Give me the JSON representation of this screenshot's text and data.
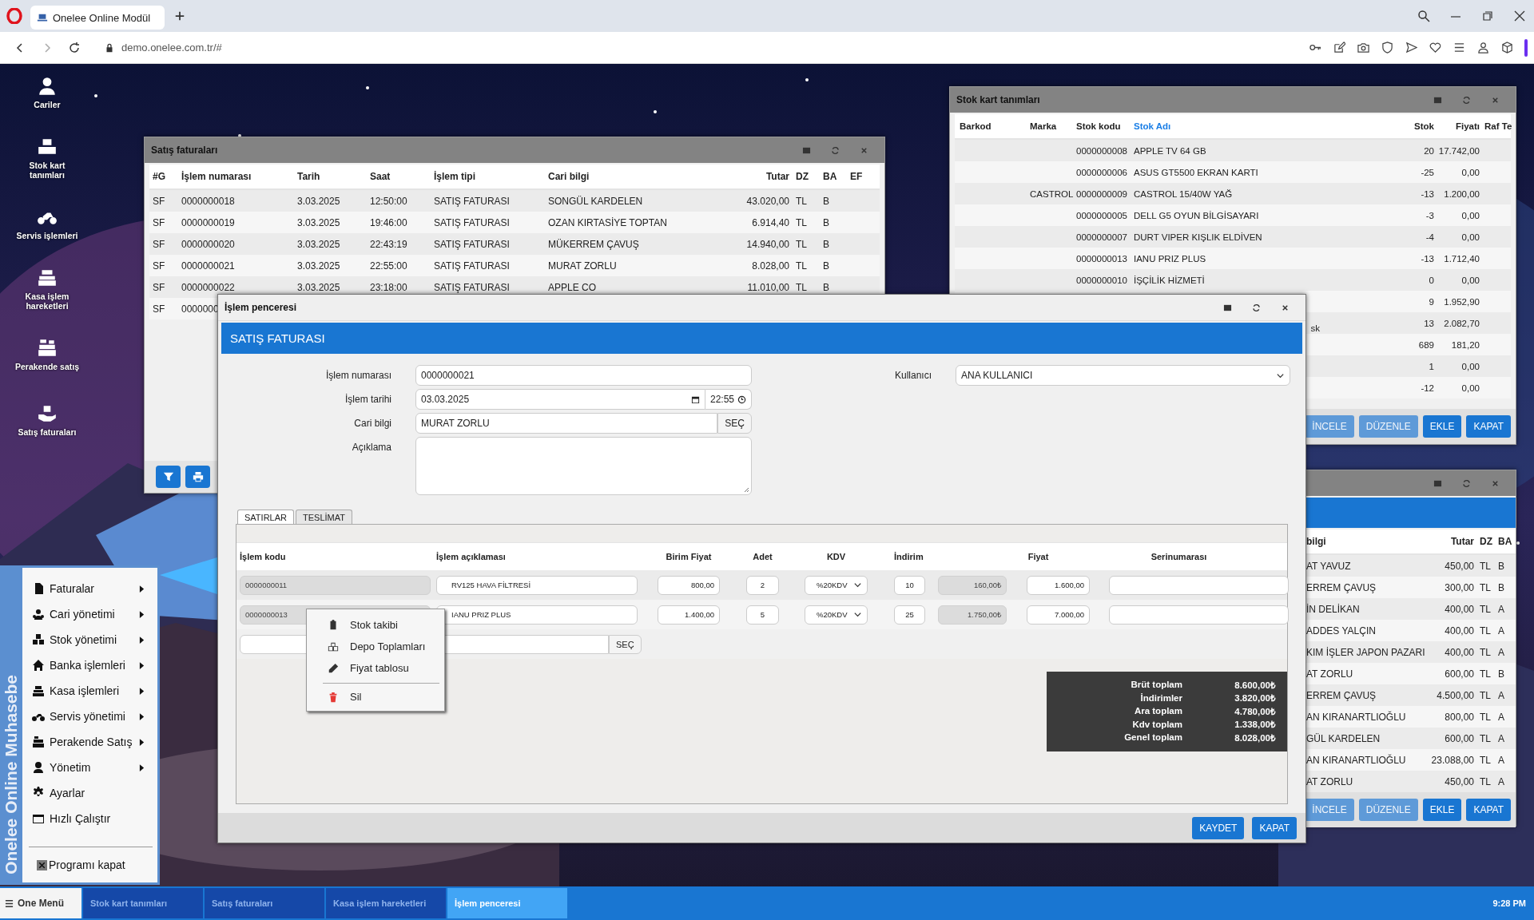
{
  "browser": {
    "tab_title": "Onelee Online Modül",
    "url": "demo.onelee.com.tr/#"
  },
  "desktop_icons": [
    {
      "label": "Cariler"
    },
    {
      "label": "Stok kart tanımları"
    },
    {
      "label": "Servis işlemleri"
    },
    {
      "label": "Kasa işlem hareketleri"
    },
    {
      "label": "Perakende satış"
    },
    {
      "label": "Satış faturaları"
    }
  ],
  "sales_window": {
    "title": "Satış faturaları",
    "columns": [
      "#G",
      "İşlem numarası",
      "Tarih",
      "Saat",
      "İşlem tipi",
      "Cari bilgi",
      "Tutar",
      "DZ",
      "BA",
      "EF"
    ],
    "rows": [
      [
        "SF",
        "0000000018",
        "3.03.2025",
        "12:50:00",
        "SATIŞ FATURASI",
        "SONGÜL KARDELEN",
        "43.020,00",
        "TL",
        "B"
      ],
      [
        "SF",
        "0000000019",
        "3.03.2025",
        "19:46:00",
        "SATIŞ FATURASI",
        "OZAN KIRTASİYE TOPTAN",
        "6.914,40",
        "TL",
        "B"
      ],
      [
        "SF",
        "0000000020",
        "3.03.2025",
        "22:43:19",
        "SATIŞ FATURASI",
        "MÜKERREM ÇAVUŞ",
        "14.940,00",
        "TL",
        "B"
      ],
      [
        "SF",
        "0000000021",
        "3.03.2025",
        "22:55:00",
        "SATIŞ FATURASI",
        "MURAT ZORLU",
        "8.028,00",
        "TL",
        "B"
      ],
      [
        "SF",
        "0000000022",
        "3.03.2025",
        "23:18:00",
        "SATIŞ FATURASI",
        "APPLE CO",
        "11.010,00",
        "TL",
        "B"
      ],
      [
        "SF",
        "0000000"
      ]
    ]
  },
  "stock_window": {
    "title": "Stok kart tanımları",
    "columns": [
      {
        "label": "Barkod",
        "sorted": false
      },
      {
        "label": "Marka",
        "sorted": false
      },
      {
        "label": "Stok kodu",
        "sorted": false
      },
      {
        "label": "Stok Adı",
        "sorted": true
      },
      {
        "label": "Stok",
        "sorted": false
      },
      {
        "label": "Fiyatı",
        "sorted": false
      },
      {
        "label": "Raf Te",
        "sorted": false
      }
    ],
    "rows": [
      {
        "code": "0000000008",
        "name": "APPLE TV 64 GB",
        "stock": "20",
        "price": "17.742,00"
      },
      {
        "code": "0000000006",
        "name": "ASUS GT5500 EKRAN KARTI",
        "stock": "-25",
        "price": "0,00"
      },
      {
        "brand": "CASTROL",
        "code": "0000000009",
        "name": "CASTROL 15/40W YAĞ",
        "stock": "-13",
        "price": "1.200,00"
      },
      {
        "code": "0000000005",
        "name": "DELL G5 OYUN BİLGİSAYARI",
        "stock": "-3",
        "price": "0,00"
      },
      {
        "code": "0000000007",
        "name": "DURT VIPER KIŞLIK ELDİVEN",
        "stock": "-4",
        "price": "0,00"
      },
      {
        "code": "0000000013",
        "name": "IANU PRIZ PLUS",
        "stock": "-13",
        "price": "1.712,40"
      },
      {
        "code": "0000000010",
        "name": "İŞÇİLİK HİZMETİ",
        "stock": "0",
        "price": "0,00"
      },
      {
        "stock": "9",
        "price": "1.952,90"
      },
      {
        "name_end": "sk",
        "stock": "13",
        "price": "2.082,70"
      },
      {
        "stock": "689",
        "price": "181,20"
      },
      {
        "stock": "1",
        "price": "0,00"
      },
      {
        "stock": "-12",
        "price": "0,00"
      }
    ],
    "buttons": [
      {
        "label": "İNCELE",
        "disabled": true
      },
      {
        "label": "DÜZENLE",
        "disabled": true
      },
      {
        "label": "EKLE",
        "disabled": false
      },
      {
        "label": "KAPAT",
        "disabled": false
      }
    ]
  },
  "third_window": {
    "columns": [
      "bilgi",
      "Tutar",
      "DZ",
      "BA"
    ],
    "rows": [
      [
        "AT YAVUZ",
        "450,00",
        "TL",
        "B"
      ],
      [
        "ERREM ÇAVUŞ",
        "300,00",
        "TL",
        "B"
      ],
      [
        "İN DELİKAN",
        "400,00",
        "TL",
        "A"
      ],
      [
        "ADDES YALÇIN",
        "400,00",
        "TL",
        "A"
      ],
      [
        "KIM İŞLER JAPON PAZARI",
        "400,00",
        "TL",
        "A"
      ],
      [
        "AT ZORLU",
        "600,00",
        "TL",
        "B"
      ],
      [
        "ERREM ÇAVUŞ",
        "4.500,00",
        "TL",
        "A"
      ],
      [
        "AN KIRANARTLIOĞLU",
        "800,00",
        "TL",
        "A"
      ],
      [
        "GÜL KARDELEN",
        "600,00",
        "TL",
        "A"
      ],
      [
        "AN KIRANARTLIOĞLU",
        "23.088,00",
        "TL",
        "A"
      ],
      [
        "AT ZORLU",
        "450,00",
        "TL",
        "A"
      ]
    ],
    "buttons": [
      {
        "label": "İNCELE",
        "disabled": true
      },
      {
        "label": "DÜZENLE",
        "disabled": true
      },
      {
        "label": "EKLE",
        "disabled": false
      },
      {
        "label": "KAPAT",
        "disabled": false
      }
    ]
  },
  "transaction_window": {
    "title": "İşlem penceresi",
    "header": "SATIŞ FATURASI",
    "fields": {
      "number": {
        "label": "İşlem numarası",
        "value": "0000000021"
      },
      "date": {
        "label": "İşlem tarihi",
        "value": "03.03.2025",
        "time": "22:55"
      },
      "customer": {
        "label": "Cari bilgi",
        "value": "MURAT ZORLU",
        "button": "SEÇ"
      },
      "note": {
        "label": "Açıklama"
      },
      "user": {
        "label": "Kullanıcı",
        "value": "ANA KULLANICI"
      }
    },
    "tabs": [
      {
        "label": "SATIRLAR",
        "selected": true
      },
      {
        "label": "TESLİMAT",
        "selected": false
      }
    ],
    "line_columns": [
      "İşlem kodu",
      "İşlem açıklaması",
      "Birim Fiyat",
      "Adet",
      "KDV",
      "İndirim",
      "Fiyat",
      "Serinumarası"
    ],
    "lines": [
      {
        "code": "0000000011",
        "description": "RV125 HAVA FİLTRESİ",
        "unit_price": "800,00",
        "quantity": "2",
        "vat": "%20KDV",
        "discount_rate": "10",
        "discount_amount": "160,00₺",
        "price": "1.600,00"
      },
      {
        "code": "0000000013",
        "description": "IANU PRIZ PLUS",
        "unit_price": "1.400,00",
        "quantity": "5",
        "vat": "%20KDV",
        "discount_rate": "25",
        "discount_amount": "1.750,00₺",
        "price": "7.000,00"
      }
    ],
    "new_line_button": "SEÇ",
    "totals": [
      {
        "label": "Brüt toplam",
        "value": "8.600,00₺"
      },
      {
        "label": "İndirimler",
        "value": "3.820,00₺"
      },
      {
        "label": "Ara toplam",
        "value": "4.780,00₺"
      },
      {
        "label": "Kdv toplam",
        "value": "1.338,00₺"
      },
      {
        "label": "Genel toplam",
        "value": "8.028,00₺"
      }
    ],
    "buttons": [
      "KAYDET",
      "KAPAT"
    ]
  },
  "context_menu": [
    {
      "label": "Stok takibi",
      "kind": "action"
    },
    {
      "label": "Depo Toplamları",
      "kind": "action"
    },
    {
      "label": "Fiyat tablosu",
      "kind": "action"
    },
    {
      "label": "Sil",
      "kind": "delete"
    }
  ],
  "start_menu": {
    "brand": "Onelee Online Muhasebe",
    "items": [
      {
        "label": "Faturalar",
        "submenu": true
      },
      {
        "label": "Cari yönetimi",
        "submenu": true
      },
      {
        "label": "Stok yönetimi",
        "submenu": true
      },
      {
        "label": "Banka işlemleri",
        "submenu": true
      },
      {
        "label": "Kasa işlemleri",
        "submenu": true
      },
      {
        "label": "Servis yönetimi",
        "submenu": true
      },
      {
        "label": "Perakende Satış",
        "submenu": true
      },
      {
        "label": "Yönetim",
        "submenu": true
      },
      {
        "label": "Ayarlar",
        "submenu": false
      },
      {
        "label": "Hızlı Çalıştır",
        "submenu": false
      }
    ],
    "exit": "Programı kapat"
  },
  "taskbar": {
    "start": "One Menü",
    "items": [
      {
        "label": "Stok kart tanımları",
        "selected": false
      },
      {
        "label": "Satış faturaları",
        "selected": false
      },
      {
        "label": "Kasa işlem hareketleri",
        "selected": false
      },
      {
        "label": "İşlem penceresi",
        "selected": true
      }
    ],
    "clock": "9:28 PM"
  }
}
